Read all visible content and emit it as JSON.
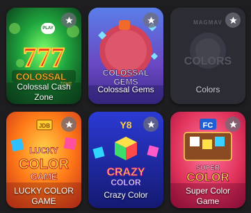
{
  "games": [
    {
      "name": "Colossal Cash Zone",
      "art_text": "COLOSSAL",
      "art_sub": "ZONE",
      "badge": "PLAY",
      "colors": [
        "#1c9a3b",
        "#0e5a24"
      ]
    },
    {
      "name": "Colossal Gems",
      "art_text": "COLOSSAL GEMS",
      "colors": [
        "#4a5fd0",
        "#6b3aa8"
      ]
    },
    {
      "name": "Colors",
      "art_text": "COLORS",
      "art_sub": "MAGMAV",
      "colors": [
        "#2b2b34",
        "#3a3a44"
      ]
    },
    {
      "name": "LUCKY COLOR GAME",
      "art_text": "LUCKY COLOR GAME",
      "art_sub": "JDB",
      "colors": [
        "#ff7a12",
        "#d8421a"
      ]
    },
    {
      "name": "Crazy Color",
      "art_text": "CRAZY COLOR",
      "art_sub": "Y8",
      "colors": [
        "#2430b8",
        "#1a1f86"
      ]
    },
    {
      "name": "Super Color Game",
      "art_text": "SUPER COLOR GAME",
      "art_sub": "FC",
      "colors": [
        "#e23a5a",
        "#b01c4a"
      ]
    }
  ],
  "favorite_icon": "star-icon"
}
